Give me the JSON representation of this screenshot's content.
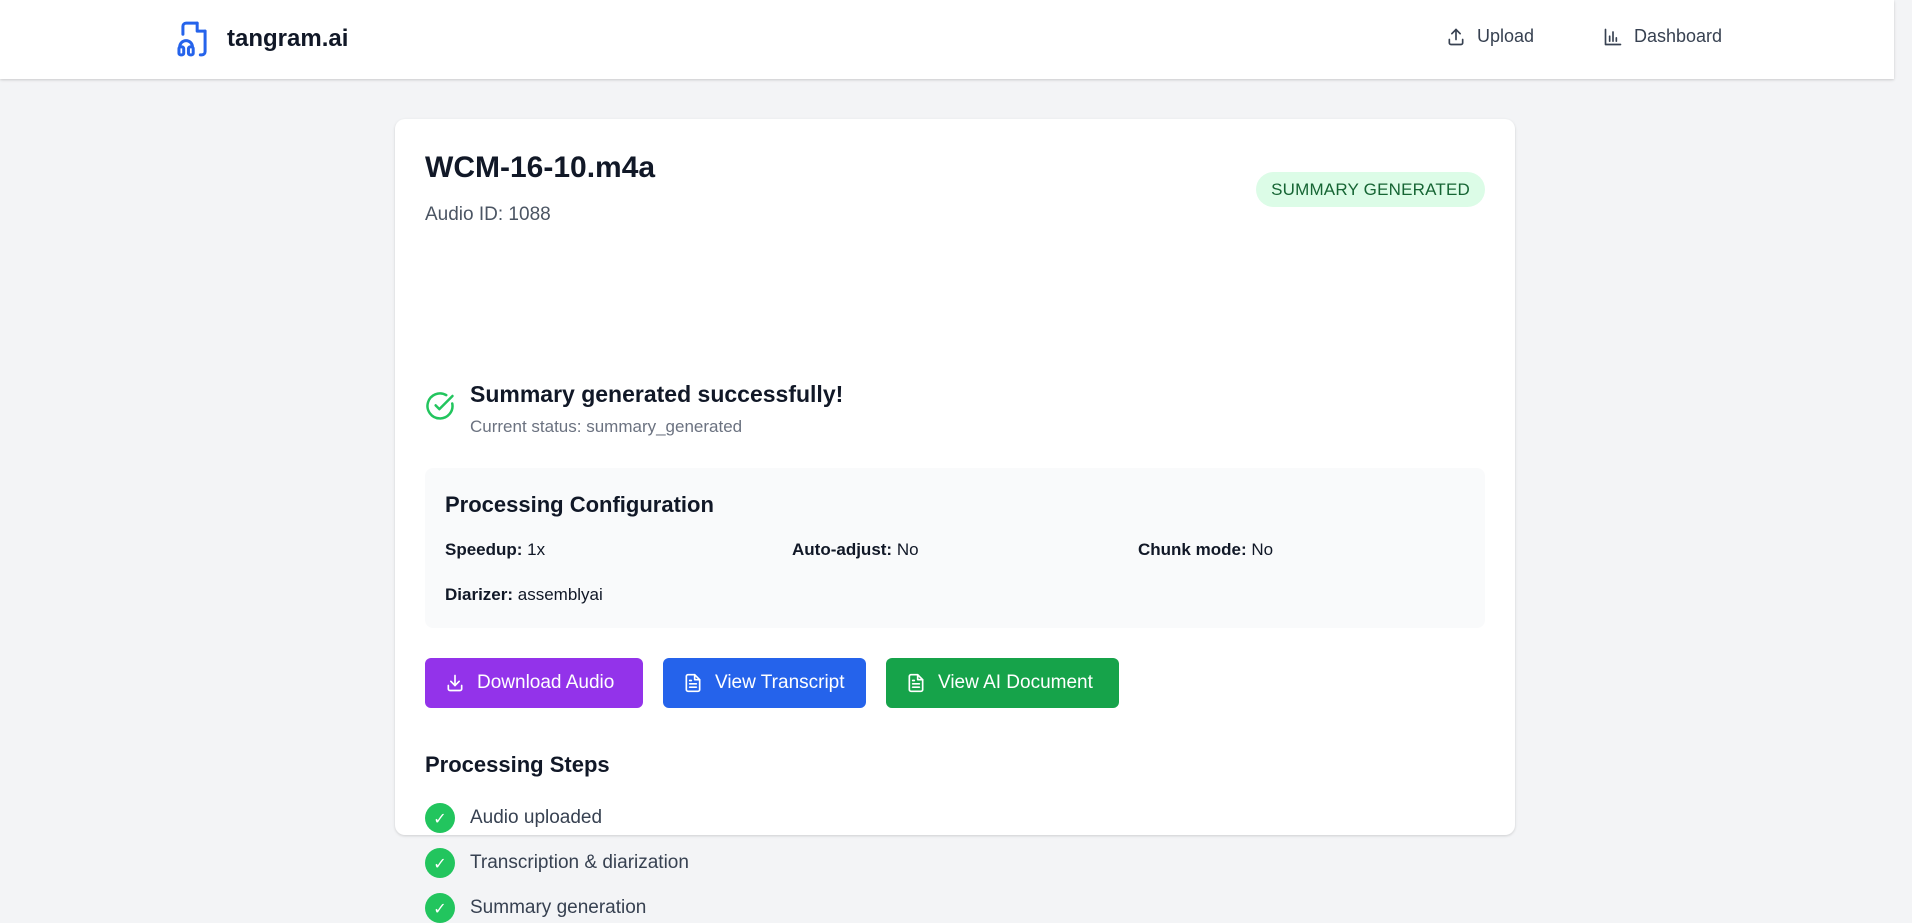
{
  "brand": {
    "name": "tangram.ai",
    "icon": "audio-file-icon"
  },
  "nav": {
    "upload": {
      "label": "Upload",
      "icon": "upload-icon"
    },
    "dashboard": {
      "label": "Dashboard",
      "icon": "bar-chart-icon"
    }
  },
  "file": {
    "title": "WCM-16-10.m4a",
    "audio_id": "Audio ID: 1088",
    "status_badge": "SUMMARY GENERATED"
  },
  "message": {
    "title": "Summary generated successfully!",
    "subtitle": "Current status: summary_generated",
    "icon": "check-circle-icon"
  },
  "config": {
    "title": "Processing Configuration",
    "speedup": {
      "key": "Speedup:",
      "value": " 1x"
    },
    "auto_adjust": {
      "key": "Auto-adjust:",
      "value": " No"
    },
    "chunk_mode": {
      "key": "Chunk mode:",
      "value": " No"
    },
    "diarizer": {
      "key": "Diarizer:",
      "value": " assemblyai"
    }
  },
  "actions": {
    "download_audio": "Download Audio",
    "view_transcript": "View Transcript",
    "view_ai_document": "View AI Document"
  },
  "steps": {
    "title": "Processing Steps",
    "items": [
      {
        "label": "Audio uploaded",
        "mark": "✓"
      },
      {
        "label": "Transcription & diarization",
        "mark": "✓"
      },
      {
        "label": "Summary generation",
        "mark": "✓"
      }
    ]
  },
  "colors": {
    "brand_blue": "#2563eb",
    "purple": "#9333ea",
    "blue": "#2563eb",
    "green": "#16a34a",
    "success": "#22c55e",
    "badge_bg": "#dcfce7",
    "badge_text": "#166534"
  }
}
